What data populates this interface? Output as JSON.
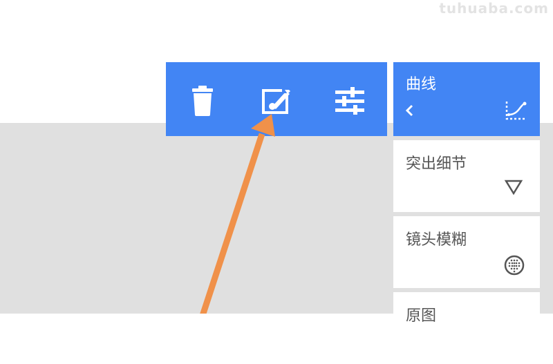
{
  "watermark": "tuhuaba.com",
  "toolbar": {
    "buttons": [
      {
        "name": "delete",
        "icon": "trash-icon"
      },
      {
        "name": "edit",
        "icon": "edit-brush-icon"
      },
      {
        "name": "adjust",
        "icon": "sliders-icon"
      }
    ]
  },
  "panel": {
    "header": {
      "title": "曲线",
      "back_icon": "chevron-left-icon",
      "right_icon": "curve-icon"
    },
    "items": [
      {
        "label": "突出细节",
        "icon": "triangle-down-icon"
      },
      {
        "label": "镜头模糊",
        "icon": "dotted-circle-icon"
      },
      {
        "label": "原图"
      }
    ]
  },
  "annotation": {
    "icon": "orange-arrow",
    "color": "#f0914a"
  },
  "colors": {
    "accent": "#4285f4",
    "background_gray": "#e0e0e0",
    "card_text": "#555555",
    "arrow": "#f0914a"
  }
}
